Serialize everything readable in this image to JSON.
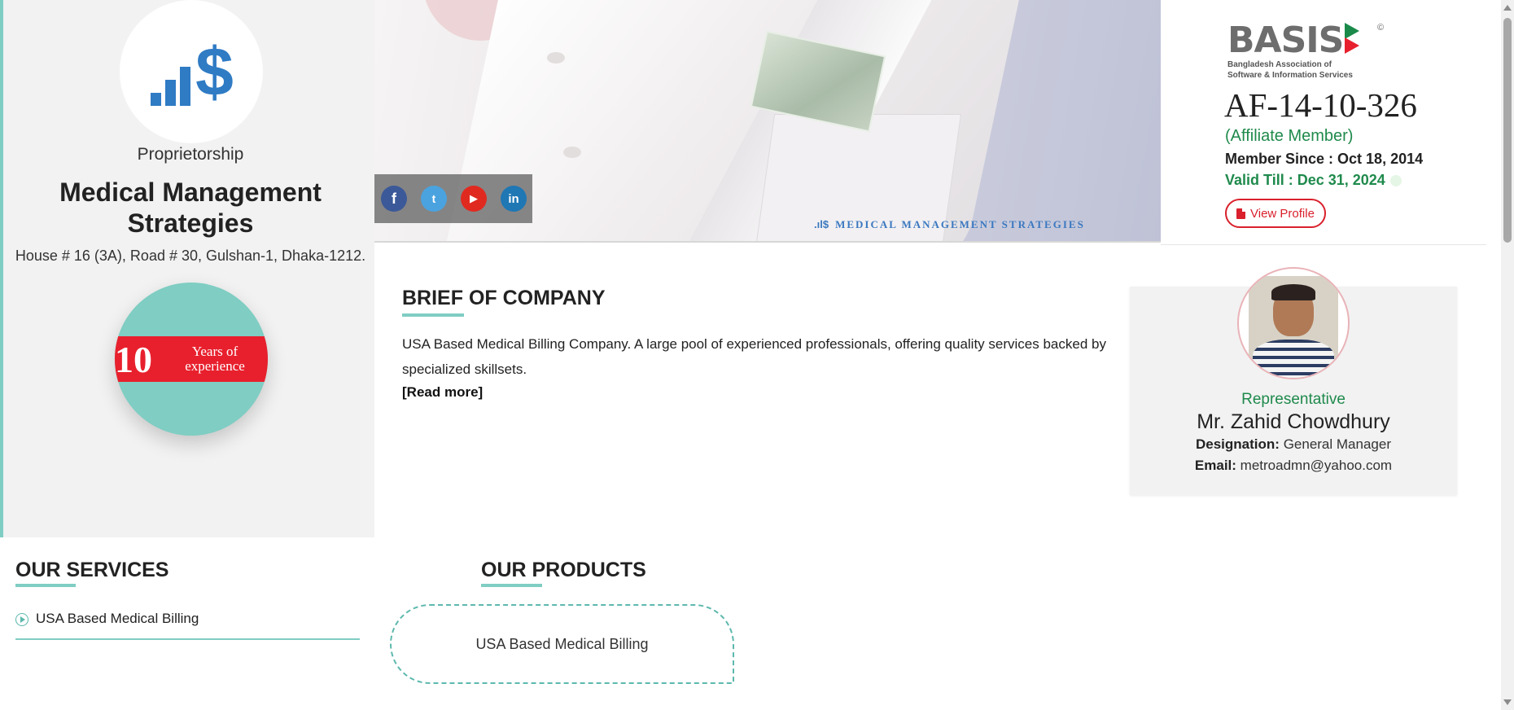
{
  "company": {
    "logo_symbol": "$",
    "org_type": "Proprietorship",
    "name": "Medical Management Strategies",
    "address": "House # 16 (3A), Road # 30, Gulshan-1, Dhaka-1212.",
    "experience": {
      "number": "10",
      "label": "Years of experience"
    }
  },
  "banner": {
    "tagline": "MEDICAL MANAGEMENT STRATEGIES",
    "tag_bars": ".ıl$",
    "social": [
      {
        "name": "facebook",
        "glyph": "f"
      },
      {
        "name": "twitter",
        "glyph": "t"
      },
      {
        "name": "youtube",
        "glyph": "▶"
      },
      {
        "name": "linkedin",
        "glyph": "in"
      }
    ]
  },
  "membership": {
    "logo_word": "BASIS",
    "logo_reg": "©",
    "logo_sub_line1": "Bangladesh Association of",
    "logo_sub_line2": "Software & Information Services",
    "member_id": "AF-14-10-326",
    "member_type": "(Affiliate Member)",
    "member_since": "Member Since : Oct 18, 2014",
    "valid_till": "Valid Till : Dec 31, 2024",
    "view_profile_label": "View Profile"
  },
  "brief": {
    "title": "BRIEF OF COMPANY",
    "text": "USA Based Medical Billing Company. A large pool of experienced professionals, offering quality services backed by specialized skillsets.",
    "read_more": "[Read more]"
  },
  "representative": {
    "role": "Representative",
    "name": "Mr. Zahid Chowdhury",
    "designation_label": "Designation:",
    "designation": "General Manager",
    "email_label": "Email:",
    "email": "metroadmn@yahoo.com"
  },
  "services": {
    "title": "OUR SERVICES",
    "items": [
      "USA Based Medical Billing"
    ]
  },
  "products": {
    "title": "OUR PRODUCTS",
    "items": [
      "USA Based Medical Billing"
    ]
  },
  "colors": {
    "accent_teal": "#7fcdc3",
    "brand_blue": "#2f7bc4",
    "success_green": "#1f8a4c",
    "alert_red": "#d9202c"
  }
}
